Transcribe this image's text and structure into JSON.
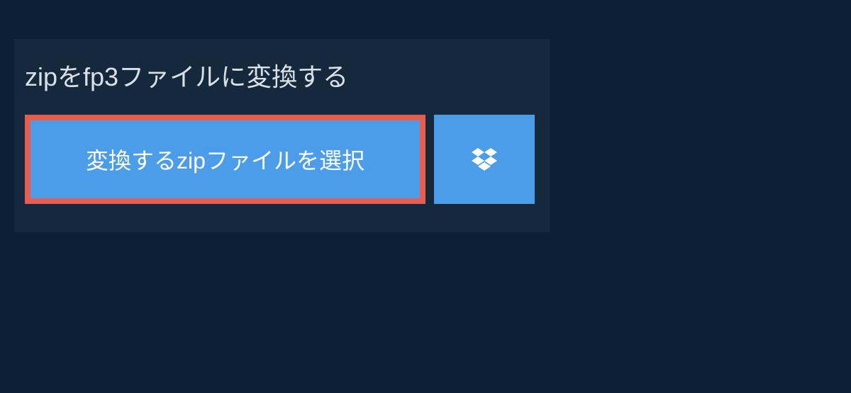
{
  "title": "zipをfp3ファイルに変換する",
  "select_button_label": "変換するzipファイルを選択",
  "colors": {
    "background": "#0d1f33",
    "panel": "#16283c",
    "button": "#4b9de9",
    "button_border": "#e75d50",
    "text_light": "#d8e0e8",
    "text_white": "#ffffff"
  }
}
